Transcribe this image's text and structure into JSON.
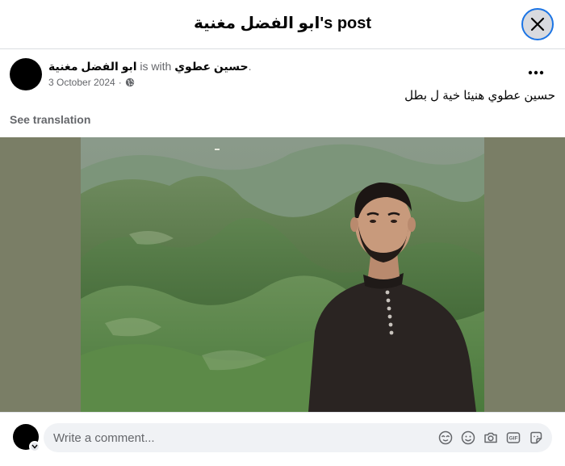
{
  "dialog": {
    "title": "ابو الفضل مغنية's post"
  },
  "post": {
    "author": "ابو الفضل مغنية",
    "is_with": " is with ",
    "tagged": "حسين عطوي",
    "tagged_suffix": ".",
    "date": "3 October 2024",
    "separator": " · ",
    "audience_icon": "globe-icon",
    "text": "حسين عطوي هنيئا خية ل بطل",
    "see_translation": "See translation"
  },
  "comment": {
    "placeholder": "Write a comment...",
    "icons": [
      "avatar-sticker-icon",
      "emoji-icon",
      "camera-icon",
      "gif-icon",
      "sticker-icon"
    ]
  },
  "colors": {
    "accent": "#1b74e4",
    "muted_text": "#65676b",
    "photo_bg": "#7a7e66"
  }
}
